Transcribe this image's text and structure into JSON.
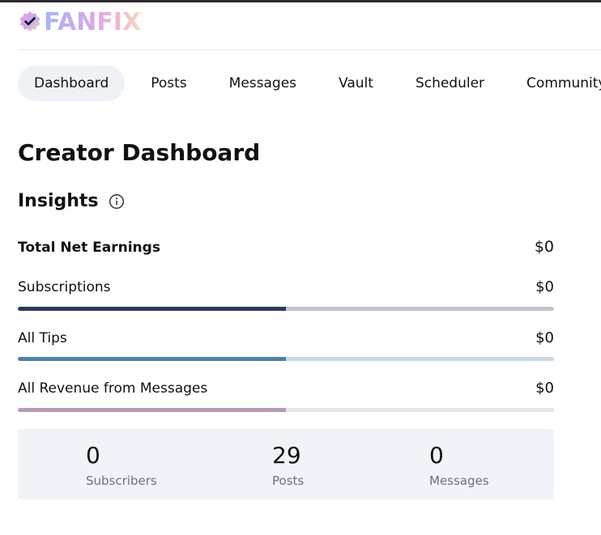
{
  "brand": {
    "logo_text": "FANFIX",
    "badge_icon": "check-badge-icon"
  },
  "nav": {
    "items": [
      {
        "label": "Dashboard",
        "active": true
      },
      {
        "label": "Posts",
        "active": false
      },
      {
        "label": "Messages",
        "active": false
      },
      {
        "label": "Vault",
        "active": false
      },
      {
        "label": "Scheduler",
        "active": false
      },
      {
        "label": "Community",
        "active": false
      }
    ]
  },
  "page": {
    "title": "Creator Dashboard"
  },
  "insights": {
    "title": "Insights",
    "info_icon": "info-icon",
    "total": {
      "label": "Total Net Earnings",
      "value": "$0"
    },
    "rows": [
      {
        "label": "Subscriptions",
        "value": "$0",
        "fill_fraction": 0.5,
        "fill_color": "#2b3a55",
        "track_color": "#bfc4ce"
      },
      {
        "label": "All Tips",
        "value": "$0",
        "fill_fraction": 0.5,
        "fill_color": "#4e82a6",
        "track_color": "#c9d8e2"
      },
      {
        "label": "All Revenue from Messages",
        "value": "$0",
        "fill_fraction": 0.5,
        "fill_color": "#b59ab4",
        "track_color": "#e9e4e8"
      }
    ]
  },
  "stats": [
    {
      "value": "0",
      "label": "Subscribers"
    },
    {
      "value": "29",
      "label": "Posts"
    },
    {
      "value": "0",
      "label": "Messages"
    }
  ]
}
